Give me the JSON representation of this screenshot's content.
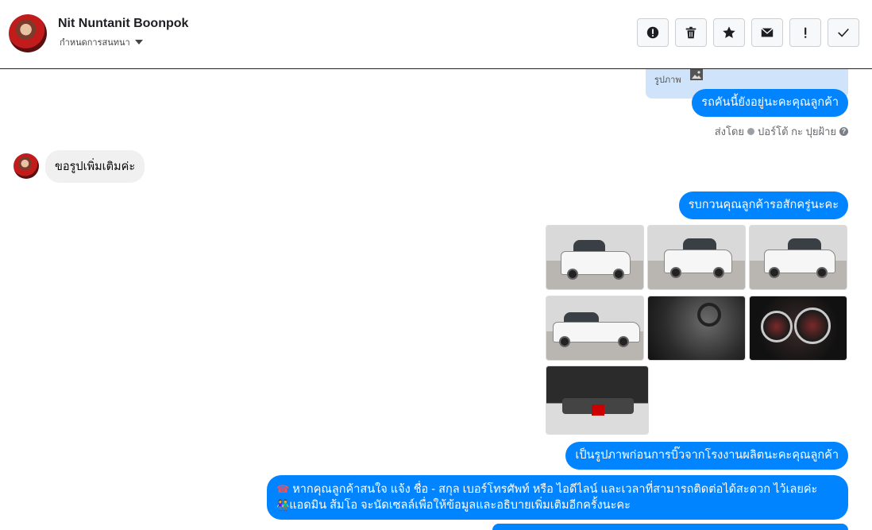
{
  "header": {
    "contact_name": "Nit Nuntanit Boonpok",
    "conversation_setting": "กำหนดการสนทนา",
    "toolbar": [
      {
        "name": "report-icon"
      },
      {
        "name": "trash-icon"
      },
      {
        "name": "star-icon"
      },
      {
        "name": "envelope-icon"
      },
      {
        "name": "exclamation-icon"
      },
      {
        "name": "checkmark-icon"
      }
    ]
  },
  "messages": {
    "previous_card_label": "รูปภาพ",
    "m1": "รถคันนี้ยังอยู่นะคะคุณลูกค้า",
    "sent_by_prefix": "ส่งโดย",
    "sent_by_name": "ปอร์โต้ กะ ปุยฝ้าย",
    "customer_msg": "ขอรูปเพิ่มเติมค่ะ",
    "m2": "รบกวนคุณลูกค้ารอสักครู่นะคะ",
    "m3": "เป็นรูปภาพก่อนการบิ๊วจากโรงงานผลิตนะคะคุณลูกค้า",
    "m4_line1": "หากคุณลูกค้าสนใจ แจ้ง ชื่อ - สกุล เบอร์โทรศัพท์ หรือ ไอดีไลน์ และเวลาที่สามารถติดต่อได้สะดวก ไว้เลยค่ะ",
    "m4_line2": "แอดมิน ส้มโอ จะนัดเซลล์เพื่อให้ข้อมูลและอธิบายเพิ่มเติมอีกครั้งนะคะ",
    "m4_emoji1": "☎",
    "m4_emoji2": "👫"
  },
  "photos": [
    {
      "name": "photo-car-front"
    },
    {
      "name": "photo-car-rear"
    },
    {
      "name": "photo-car-rear-side"
    },
    {
      "name": "photo-car-side"
    },
    {
      "name": "photo-interior"
    },
    {
      "name": "photo-gauges"
    },
    {
      "name": "photo-engine"
    }
  ],
  "colors": {
    "outgoing": "#0084ff",
    "incoming": "#f0f0f0",
    "preview": "#cfe3fb"
  }
}
